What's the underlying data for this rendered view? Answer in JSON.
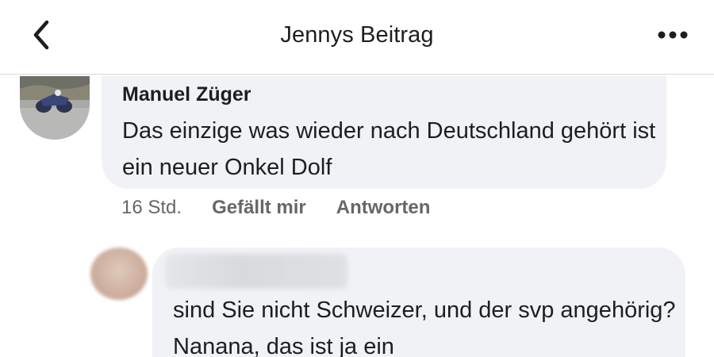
{
  "header": {
    "title": "Jennys Beitrag",
    "back_icon": "chevron-left-icon",
    "more_icon": "more-dots-icon"
  },
  "comments": [
    {
      "author": "Manuel Züger",
      "text": "Das einzige was wieder nach Deutschland gehört ist ein neuer Onkel Dolf",
      "time": "16 Std.",
      "like_label": "Gefällt mir",
      "reply_label": "Antworten"
    },
    {
      "author_hidden": true,
      "text": "sind Sie nicht Schweizer, und der svp angehörig? Nanana, das ist ja ein"
    }
  ],
  "colors": {
    "bubble": "#f0f2f5",
    "text": "#1c1e21",
    "meta": "#65676b",
    "divider": "#d8dadf"
  }
}
